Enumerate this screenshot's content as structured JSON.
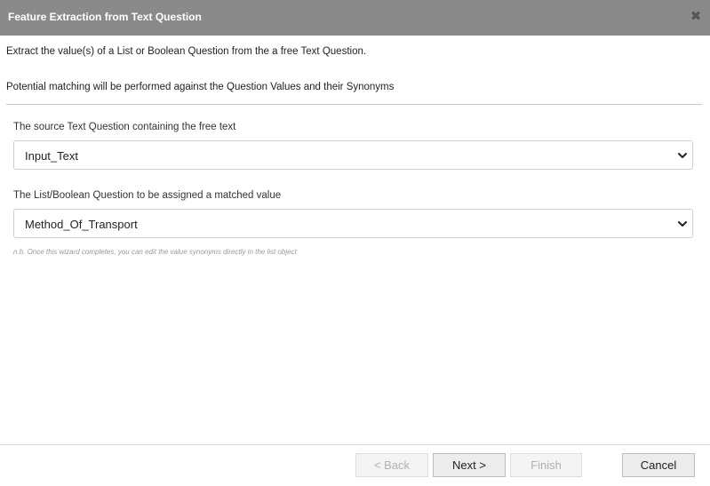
{
  "dialog": {
    "title": "Feature Extraction from Text Question",
    "close_symbol": "✖"
  },
  "intro": {
    "line1": "Extract the value(s) of a List or Boolean Question from the a free Text Question.",
    "line2": "Potential matching will be performed against the Question Values and their Synonyms"
  },
  "fields": {
    "source": {
      "label": "The source Text Question containing the free text",
      "value": "Input_Text"
    },
    "target": {
      "label": "The List/Boolean Question to be assigned a matched value",
      "value": "Method_Of_Transport"
    }
  },
  "note": "n.b. Once this wizard completes, you can edit the value synonyms directly in the list object",
  "buttons": {
    "back": "< Back",
    "next": "Next >",
    "finish": "Finish",
    "cancel": "Cancel"
  },
  "icons": {
    "close": "close-icon",
    "dropdown": "chevron-down-icon"
  },
  "colors": {
    "titlebar": "#8a8a8a",
    "title_text": "#ffffff",
    "disabled_text": "#b0b0b0"
  }
}
